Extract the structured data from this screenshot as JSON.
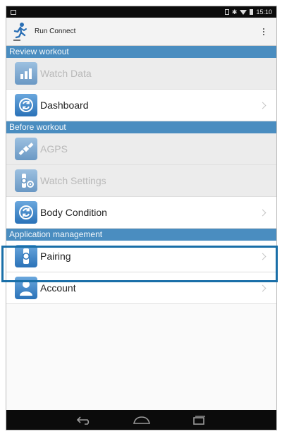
{
  "status_bar": {
    "time": "15:10",
    "icons": [
      "image-icon",
      "sim-icon",
      "bluetooth-icon",
      "wifi-icon",
      "battery-icon"
    ]
  },
  "app": {
    "title": "Run Connect",
    "logo_icon": "runner-logo-icon",
    "menu_icon": "overflow-menu-icon"
  },
  "sections": [
    {
      "label": "Review workout",
      "items": [
        {
          "label": "Watch Data",
          "icon": "bar-chart-icon",
          "enabled": false
        },
        {
          "label": "Dashboard",
          "icon": "refresh-icon",
          "enabled": true
        }
      ]
    },
    {
      "label": "Before workout",
      "items": [
        {
          "label": "AGPS",
          "icon": "satellite-icon",
          "enabled": false
        },
        {
          "label": "Watch Settings",
          "icon": "watch-gear-icon",
          "enabled": false
        },
        {
          "label": "Body Condition",
          "icon": "refresh-icon",
          "enabled": true
        }
      ]
    },
    {
      "label": "Application management",
      "items": [
        {
          "label": "Pairing",
          "icon": "watch-icon",
          "enabled": true,
          "highlighted": true
        },
        {
          "label": "Account",
          "icon": "person-icon",
          "enabled": true
        }
      ]
    }
  ],
  "colors": {
    "section_header": "#4a8dc0",
    "highlight_border": "#1a6fa8",
    "icon_blue": "#2a72b8"
  },
  "nav_bar": [
    "back-icon",
    "home-icon",
    "recents-icon"
  ]
}
